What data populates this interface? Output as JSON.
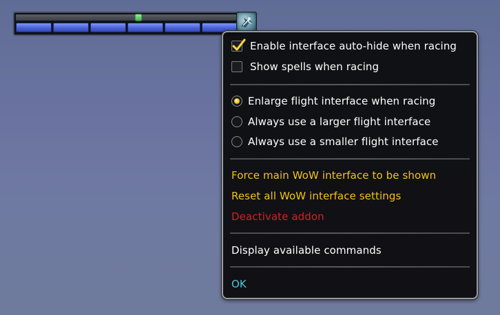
{
  "flight_bar": {
    "progress_marker_fraction": 0.555,
    "segment_count": 6,
    "button_icon": "flight-mount-icon"
  },
  "menu": {
    "checkbox_items": [
      {
        "label": "Enable interface auto-hide when racing",
        "checked": true
      },
      {
        "label": "Show spells when racing",
        "checked": false
      }
    ],
    "radio_items": [
      {
        "label": "Enlarge flight interface when racing",
        "selected": true
      },
      {
        "label": "Always use a larger flight interface",
        "selected": false
      },
      {
        "label": "Always use a smaller flight interface",
        "selected": false
      }
    ],
    "actions": [
      {
        "label": "Force main WoW interface to be shown",
        "color": "#f0c419"
      },
      {
        "label": "Reset all WoW interface settings",
        "color": "#f0c419"
      },
      {
        "label": "Deactivate addon",
        "color": "#d91f1f"
      }
    ],
    "commands_label": "Display available commands",
    "ok_label": "OK"
  },
  "colors": {
    "menu_background": "#0c0c0e",
    "menu_border": "#9a9ca0",
    "gold_text": "#f0c419",
    "red_text": "#d91f1f",
    "cyan_text": "#49c8d8",
    "check_mark": "#f2c012",
    "bar_segment": "#4a63d8",
    "progress_marker": "#3dbb3f"
  }
}
